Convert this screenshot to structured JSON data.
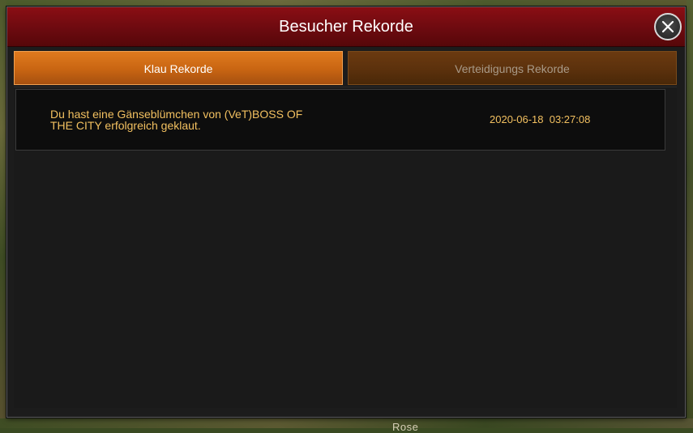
{
  "background": {
    "partial_label": "Rose"
  },
  "modal": {
    "title": "Besucher Rekorde",
    "close_icon": "close-icon",
    "colors": {
      "title_bar": "#7a0c11",
      "active_tab": "#d06a16",
      "inactive_tab": "#5a300c",
      "record_text": "#f2c060"
    }
  },
  "tabs": [
    {
      "label": "Klau Rekorde",
      "active": true
    },
    {
      "label": "Verteidigungs Rekorde",
      "active": false
    }
  ],
  "records": [
    {
      "message": "Du hast eine Gänseblümchen von (VeT)BOSS OF THE CITY erfolgreich geklaut.",
      "timestamp": "2020-06-18  03:27:08"
    }
  ]
}
